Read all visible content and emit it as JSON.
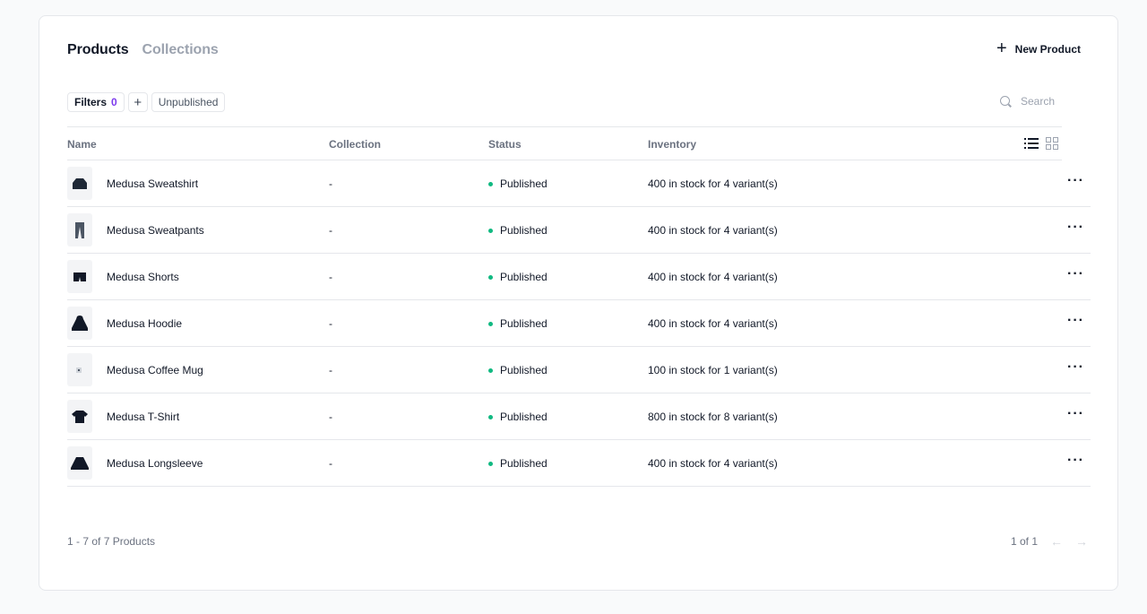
{
  "tabs": [
    {
      "label": "Products",
      "active": true
    },
    {
      "label": "Collections",
      "active": false
    }
  ],
  "new_product_label": "New Product",
  "filters": {
    "label": "Filters",
    "count": "0",
    "add_icon": "plus-icon",
    "unpublished_label": "Unpublished"
  },
  "search": {
    "placeholder": "Search"
  },
  "columns": {
    "name": "Name",
    "collection": "Collection",
    "status": "Status",
    "inventory": "Inventory"
  },
  "rows": [
    {
      "name": "Medusa Sweatshirt",
      "collection": "-",
      "status": "Published",
      "inventory": "400 in stock for 4 variant(s)",
      "icon": "sweatshirt"
    },
    {
      "name": "Medusa Sweatpants",
      "collection": "-",
      "status": "Published",
      "inventory": "400 in stock for 4 variant(s)",
      "icon": "sweatpants"
    },
    {
      "name": "Medusa Shorts",
      "collection": "-",
      "status": "Published",
      "inventory": "400 in stock for 4 variant(s)",
      "icon": "shorts"
    },
    {
      "name": "Medusa Hoodie",
      "collection": "-",
      "status": "Published",
      "inventory": "400 in stock for 4 variant(s)",
      "icon": "hoodie"
    },
    {
      "name": "Medusa Coffee Mug",
      "collection": "-",
      "status": "Published",
      "inventory": "100 in stock for 1 variant(s)",
      "icon": "mug"
    },
    {
      "name": "Medusa T-Shirt",
      "collection": "-",
      "status": "Published",
      "inventory": "800 in stock for 8 variant(s)",
      "icon": "tshirt"
    },
    {
      "name": "Medusa Longsleeve",
      "collection": "-",
      "status": "Published",
      "inventory": "400 in stock for 4 variant(s)",
      "icon": "longsleeve"
    }
  ],
  "footer": {
    "count_label": "1 - 7 of 7 Products",
    "page_label": "1 of 1"
  },
  "colors": {
    "status_published": "#10b981",
    "accent": "#7c3aed"
  }
}
